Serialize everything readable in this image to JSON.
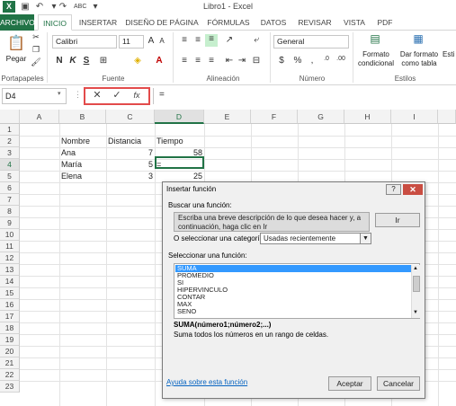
{
  "window": {
    "title": "Libro1 - Excel",
    "logo_letter": "X"
  },
  "qat": {
    "save_icon": "save-icon",
    "undo_icon": "undo-icon",
    "redo_icon": "redo-icon",
    "spell_icon": "spellcheck-icon"
  },
  "tabs": [
    {
      "label": "ARCHIVO"
    },
    {
      "label": "INICIO"
    },
    {
      "label": "INSERTAR"
    },
    {
      "label": "DISEÑO DE PÁGINA"
    },
    {
      "label": "FÓRMULAS"
    },
    {
      "label": "DATOS"
    },
    {
      "label": "REVISAR"
    },
    {
      "label": "VISTA"
    },
    {
      "label": "PDF"
    }
  ],
  "ribbon": {
    "paste_label": "Pegar",
    "font_name": "Calibri",
    "font_size": "11",
    "bold": "N",
    "italic": "K",
    "underline": "S",
    "number_format": "General",
    "conditional_format": "Formato condicional",
    "format_table": "Dar formato como tabla",
    "cell_styles": "Esti",
    "groups": {
      "clipboard": "Portapapeles",
      "font": "Fuente",
      "alignment": "Alineación",
      "number": "Número",
      "styles": "Estilos"
    }
  },
  "formula_bar": {
    "name_box": "D4",
    "cancel": "✕",
    "enter": "✓",
    "fx": "fx",
    "formula": "="
  },
  "grid": {
    "columns": [
      "A",
      "B",
      "C",
      "D",
      "E",
      "F",
      "G",
      "H",
      "I"
    ],
    "rows": [
      "1",
      "2",
      "3",
      "4",
      "5",
      "6",
      "7",
      "8",
      "9",
      "10",
      "11",
      "12",
      "13",
      "14",
      "15",
      "16",
      "17",
      "18",
      "19",
      "20",
      "21",
      "22",
      "23"
    ],
    "selected_column": "D",
    "selected_row": "4",
    "headers": {
      "nombre": "Nombre",
      "distancia": "Distancia",
      "tiempo": "Tiempo"
    },
    "data": [
      {
        "nombre": "Ana",
        "distancia": "7",
        "tiempo": "58"
      },
      {
        "nombre": "María",
        "distancia": "5",
        "tiempo": "="
      },
      {
        "nombre": "Elena",
        "distancia": "3",
        "tiempo": "25"
      }
    ]
  },
  "dialog": {
    "title": "Insertar función",
    "help": "?",
    "close": "✕",
    "search_label": "Buscar una función:",
    "search_value": "Escriba una breve descripción de lo que desea hacer y, a continuación, haga clic en Ir",
    "go_button": "Ir",
    "category_label": "O seleccionar una categoría:",
    "category_value": "Usadas recientemente",
    "function_label": "Seleccionar una función:",
    "functions": [
      "SUMA",
      "PROMEDIO",
      "SI",
      "HIPERVINCULO",
      "CONTAR",
      "MAX",
      "SENO"
    ],
    "selected_function": "SUMA",
    "signature": "SUMA(número1;número2;...)",
    "description": "Suma todos los números en un rango de celdas.",
    "help_link": "Ayuda sobre esta función",
    "ok_button": "Aceptar",
    "cancel_button": "Cancelar"
  }
}
